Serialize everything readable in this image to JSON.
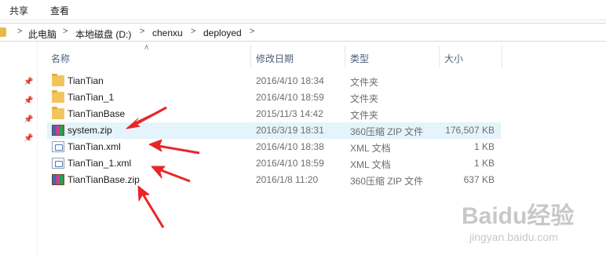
{
  "ribbon": {
    "tabs": [
      {
        "label": "共享"
      },
      {
        "label": "查看"
      }
    ]
  },
  "address": {
    "crumbs": [
      {
        "label": "此电脑"
      },
      {
        "label": "本地磁盘 (D:)"
      },
      {
        "label": "chenxu"
      },
      {
        "label": "deployed"
      }
    ],
    "separator": ">"
  },
  "columns": {
    "name": "名称",
    "date": "修改日期",
    "type": "类型",
    "size": "大小"
  },
  "files": [
    {
      "name": "TianTian",
      "date": "2016/4/10 18:34",
      "type": "文件夹",
      "size": "",
      "icon": "folder-icon"
    },
    {
      "name": "TianTian_1",
      "date": "2016/4/10 18:59",
      "type": "文件夹",
      "size": "",
      "icon": "folder-icon"
    },
    {
      "name": "TianTianBase",
      "date": "2015/11/3 14:42",
      "type": "文件夹",
      "size": "",
      "icon": "folder-icon"
    },
    {
      "name": "system.zip",
      "date": "2016/3/19 18:31",
      "type": "360压缩 ZIP 文件",
      "size": "176,507 KB",
      "icon": "zip-archive-icon"
    },
    {
      "name": "TianTian.xml",
      "date": "2016/4/10 18:38",
      "type": "XML 文档",
      "size": "1 KB",
      "icon": "xml-document-icon"
    },
    {
      "name": "TianTian_1.xml",
      "date": "2016/4/10 18:59",
      "type": "XML 文档",
      "size": "1 KB",
      "icon": "xml-document-icon"
    },
    {
      "name": "TianTianBase.zip",
      "date": "2016/1/8 11:20",
      "type": "360压缩 ZIP 文件",
      "size": "637 KB",
      "icon": "zip-archive-icon"
    }
  ],
  "selected_file": "system.zip",
  "annotation_color": "#e8262a",
  "watermark": {
    "logo": "Baidu经验",
    "site": "jingyan.baidu.com"
  }
}
